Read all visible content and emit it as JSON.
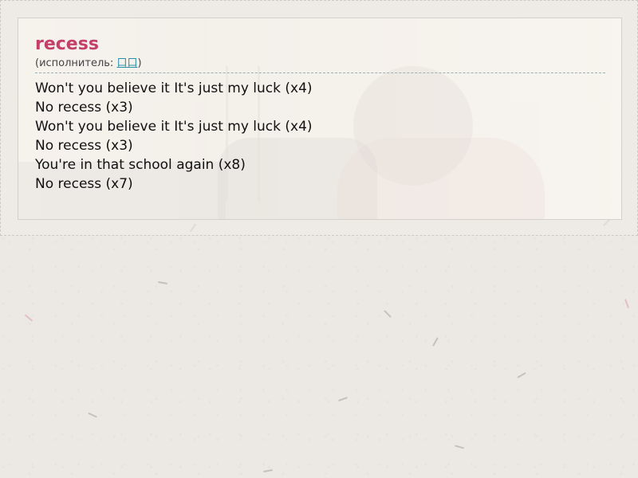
{
  "song": {
    "title": "recess",
    "artist_prefix": "(исполнитель: ",
    "artist_name": "口口",
    "artist_suffix": ")"
  },
  "lyrics": [
    "Won't you believe it It's just my luck (x4)",
    "No recess (x3)",
    "Won't you believe it It's just my luck (x4)",
    "No recess (x3)",
    "You're in that school again (x8)",
    "No recess (x7)"
  ],
  "colors": {
    "title": "#c4406a",
    "artist_link": "#2a8fa8",
    "page_background": "#ece8e4"
  }
}
